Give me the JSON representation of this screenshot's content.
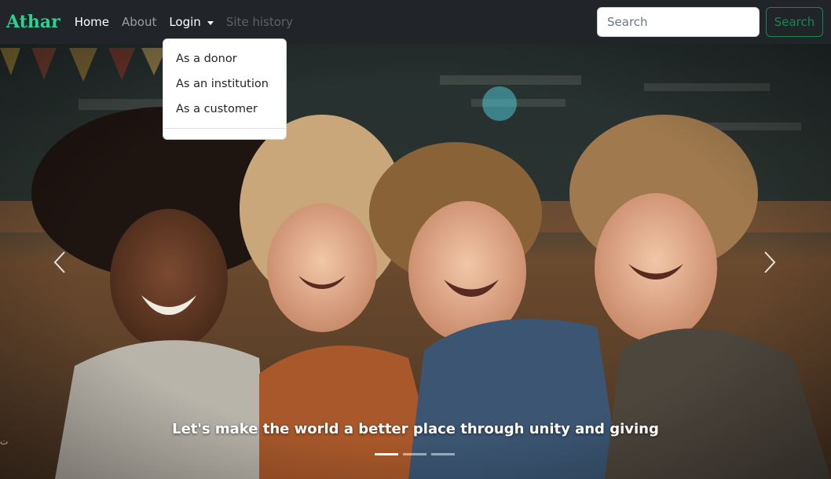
{
  "navbar": {
    "brand": "Athar",
    "links": {
      "home": "Home",
      "about": "About",
      "login": "Login",
      "site_history": "Site history"
    },
    "search": {
      "placeholder": "Search",
      "button_label": "Search"
    }
  },
  "login_dropdown": {
    "items": [
      "As a donor",
      "As an institution",
      "As a customer"
    ]
  },
  "carousel": {
    "caption": "Let's make the world a better place through unity and giving",
    "slide_count": 3,
    "active_slide": 1,
    "prev_icon": "chevron-left-icon",
    "next_icon": "chevron-right-icon"
  },
  "colors": {
    "navbar_bg": "#212529",
    "brand": "#2fd08f",
    "success": "#198754"
  }
}
